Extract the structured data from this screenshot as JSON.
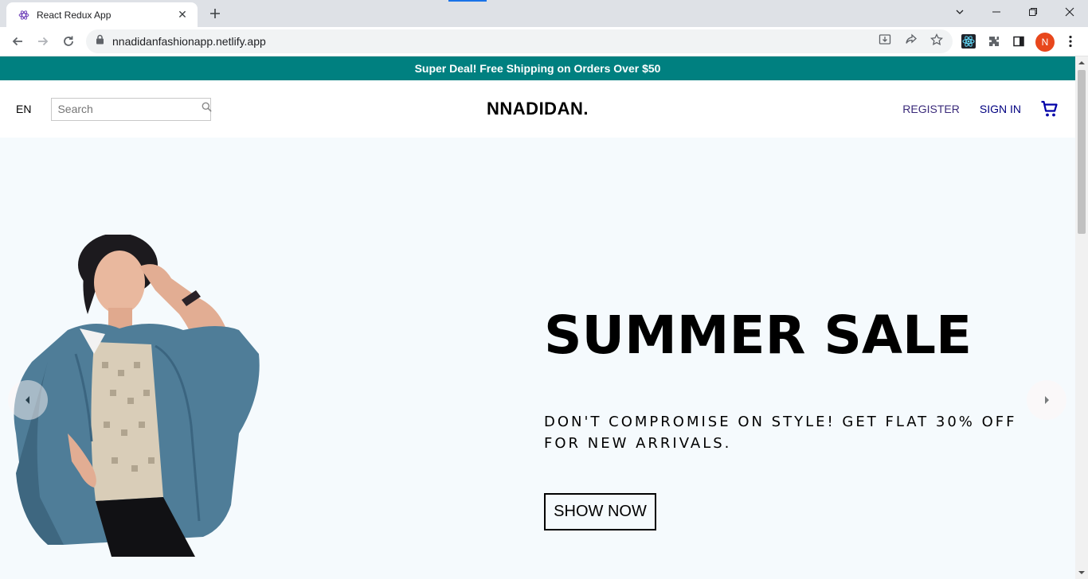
{
  "browser": {
    "tab_title": "React Redux App",
    "url": "nnadidanfashionapp.netlify.app",
    "profile_initial": "N"
  },
  "announcement": {
    "text": "Super Deal! Free Shipping on Orders Over $50",
    "background": "#008080"
  },
  "navbar": {
    "language": "EN",
    "search_placeholder": "Search",
    "logo": "NNADIDAN.",
    "register_label": "REGISTER",
    "signin_label": "SIGN IN",
    "cart_icon": "shopping-cart-icon"
  },
  "slide": {
    "title": "SUMMER SALE",
    "description": "DON'T COMPROMISE ON STYLE! GET FLAT 30% OFF FOR NEW ARRIVALS.",
    "button_label": "SHOW NOW",
    "background": "#f5fafd"
  }
}
